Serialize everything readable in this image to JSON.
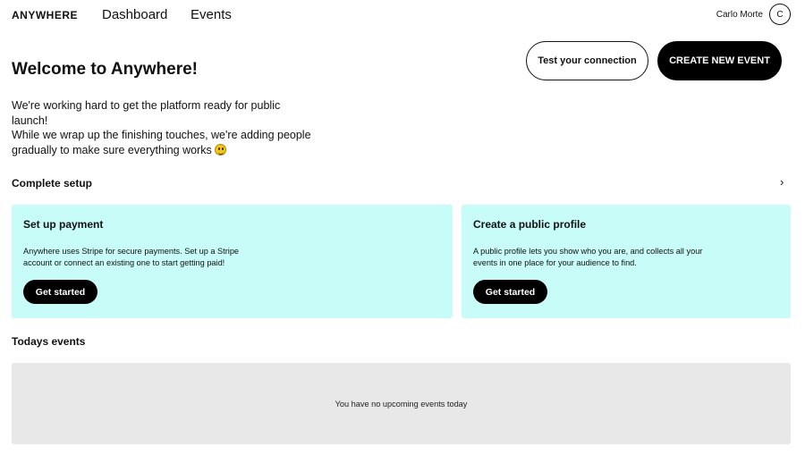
{
  "header": {
    "logo": "ANYWHERE",
    "nav": [
      "Dashboard",
      "Events"
    ],
    "user_name": "Carlo Morte",
    "avatar_initial": "C"
  },
  "welcome": {
    "title": "Welcome to Anywhere!",
    "test_button": "Test your connection",
    "create_button": "CREATE NEW EVENT",
    "intro_lines": [
      "We're working hard to get the platform ready for public launch!",
      "While we wrap up the finishing touches, we're adding people",
      "gradually to make sure everything works"
    ],
    "emoji": "grinning-face-emoji"
  },
  "setup": {
    "title": "Complete setup",
    "cards": [
      {
        "title": "Set up payment",
        "desc": "Anywhere uses Stripe for secure payments. Set up a Stripe account or connect an existing one to start getting paid!",
        "button": "Get started"
      },
      {
        "title": "Create a public profile",
        "desc": "A public profile lets you show who you are, and collects all your events in one place for your audience to find.",
        "button": "Get started"
      }
    ]
  },
  "today": {
    "title": "Todays events",
    "empty_message": "You have no upcoming events today"
  },
  "colors": {
    "card_bg": "#c8fcf8",
    "empty_bg": "#e8e8e8",
    "primary": "#000000"
  }
}
